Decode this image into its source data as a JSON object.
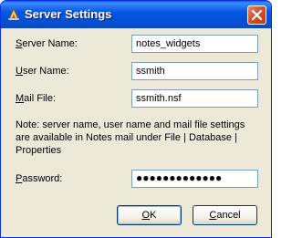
{
  "window": {
    "title": "Server Settings",
    "icon": "notes-app-icon"
  },
  "form": {
    "server_name": {
      "label_access": "S",
      "label_rest": "erver Name:",
      "value": "notes_widgets"
    },
    "user_name": {
      "label_access": "U",
      "label_rest": "ser Name:",
      "value": "ssmith"
    },
    "mail_file": {
      "label_access": "M",
      "label_rest": "ail File:",
      "value": "ssmith.nsf"
    },
    "note": "Note: server name, user name and mail file settings are available in Notes mail under File | Database | Properties",
    "password": {
      "label_access": "P",
      "label_rest": "assword:",
      "value": "●●●●●●●●●●●●●"
    }
  },
  "buttons": {
    "ok": {
      "access": "O",
      "rest": "K"
    },
    "cancel": {
      "access": "C",
      "rest": "ancel"
    }
  },
  "colors": {
    "titlebar": "#0a5bf0",
    "dialog_bg": "#ece9d8",
    "field_border": "#7f9db9",
    "close": "#d9502a"
  }
}
